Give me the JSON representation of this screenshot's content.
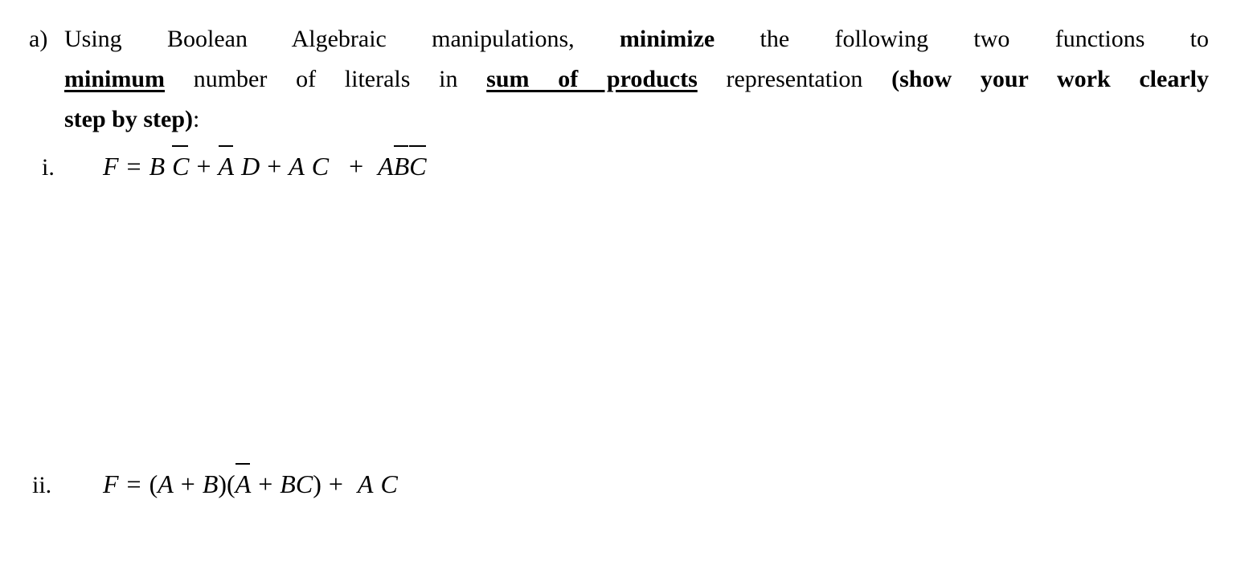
{
  "document": {
    "background_color": "#ffffff",
    "text_color": "#000000"
  },
  "part_a": {
    "marker": "a)",
    "line1": {
      "t1": "Using Boolean Algebraic manipulations, ",
      "b1": "minimize",
      "t2": " the following two functions to"
    },
    "line2": {
      "u1": "minimum",
      "t1": " number of literals in ",
      "u2": "sum of products",
      "t2": " representation ",
      "b1": "(show your work clearly"
    },
    "line3": {
      "b1": "step by step)",
      "t1": ":"
    }
  },
  "items": [
    {
      "marker": "i.",
      "equation_text": "F = B C̄ + Ā D + A C + AB̄C̄",
      "lhs": "F",
      "equals": "=",
      "terms": [
        {
          "factors": [
            {
              "sym": "B",
              "bar": false
            },
            {
              "sym": "C",
              "bar": true
            }
          ]
        },
        {
          "factors": [
            {
              "sym": "A",
              "bar": true
            },
            {
              "sym": "D",
              "bar": false
            }
          ]
        },
        {
          "factors": [
            {
              "sym": "A",
              "bar": false
            },
            {
              "sym": "C",
              "bar": false
            }
          ]
        },
        {
          "factors": [
            {
              "sym": "A",
              "bar": false
            },
            {
              "sym": "B",
              "bar": true
            },
            {
              "sym": "C",
              "bar": true
            }
          ]
        }
      ],
      "operator": "+"
    },
    {
      "marker": "ii.",
      "equation_text": "F = (A + B)(Ā + BC) + A C",
      "lhs": "F",
      "equals": "=",
      "operator": "+",
      "paren_open": "(",
      "paren_close": ")",
      "group1": [
        {
          "sym": "A",
          "bar": false
        },
        {
          "sym": "B",
          "bar": false
        }
      ],
      "group2": [
        {
          "sym": "A",
          "bar": true
        },
        {
          "sym": "B",
          "bar": false
        },
        {
          "sym": "C",
          "bar": false
        }
      ],
      "tail": [
        {
          "sym": "A",
          "bar": false
        },
        {
          "sym": "C",
          "bar": false
        }
      ]
    }
  ],
  "answer_space": {
    "label": "blank-answer-area"
  }
}
